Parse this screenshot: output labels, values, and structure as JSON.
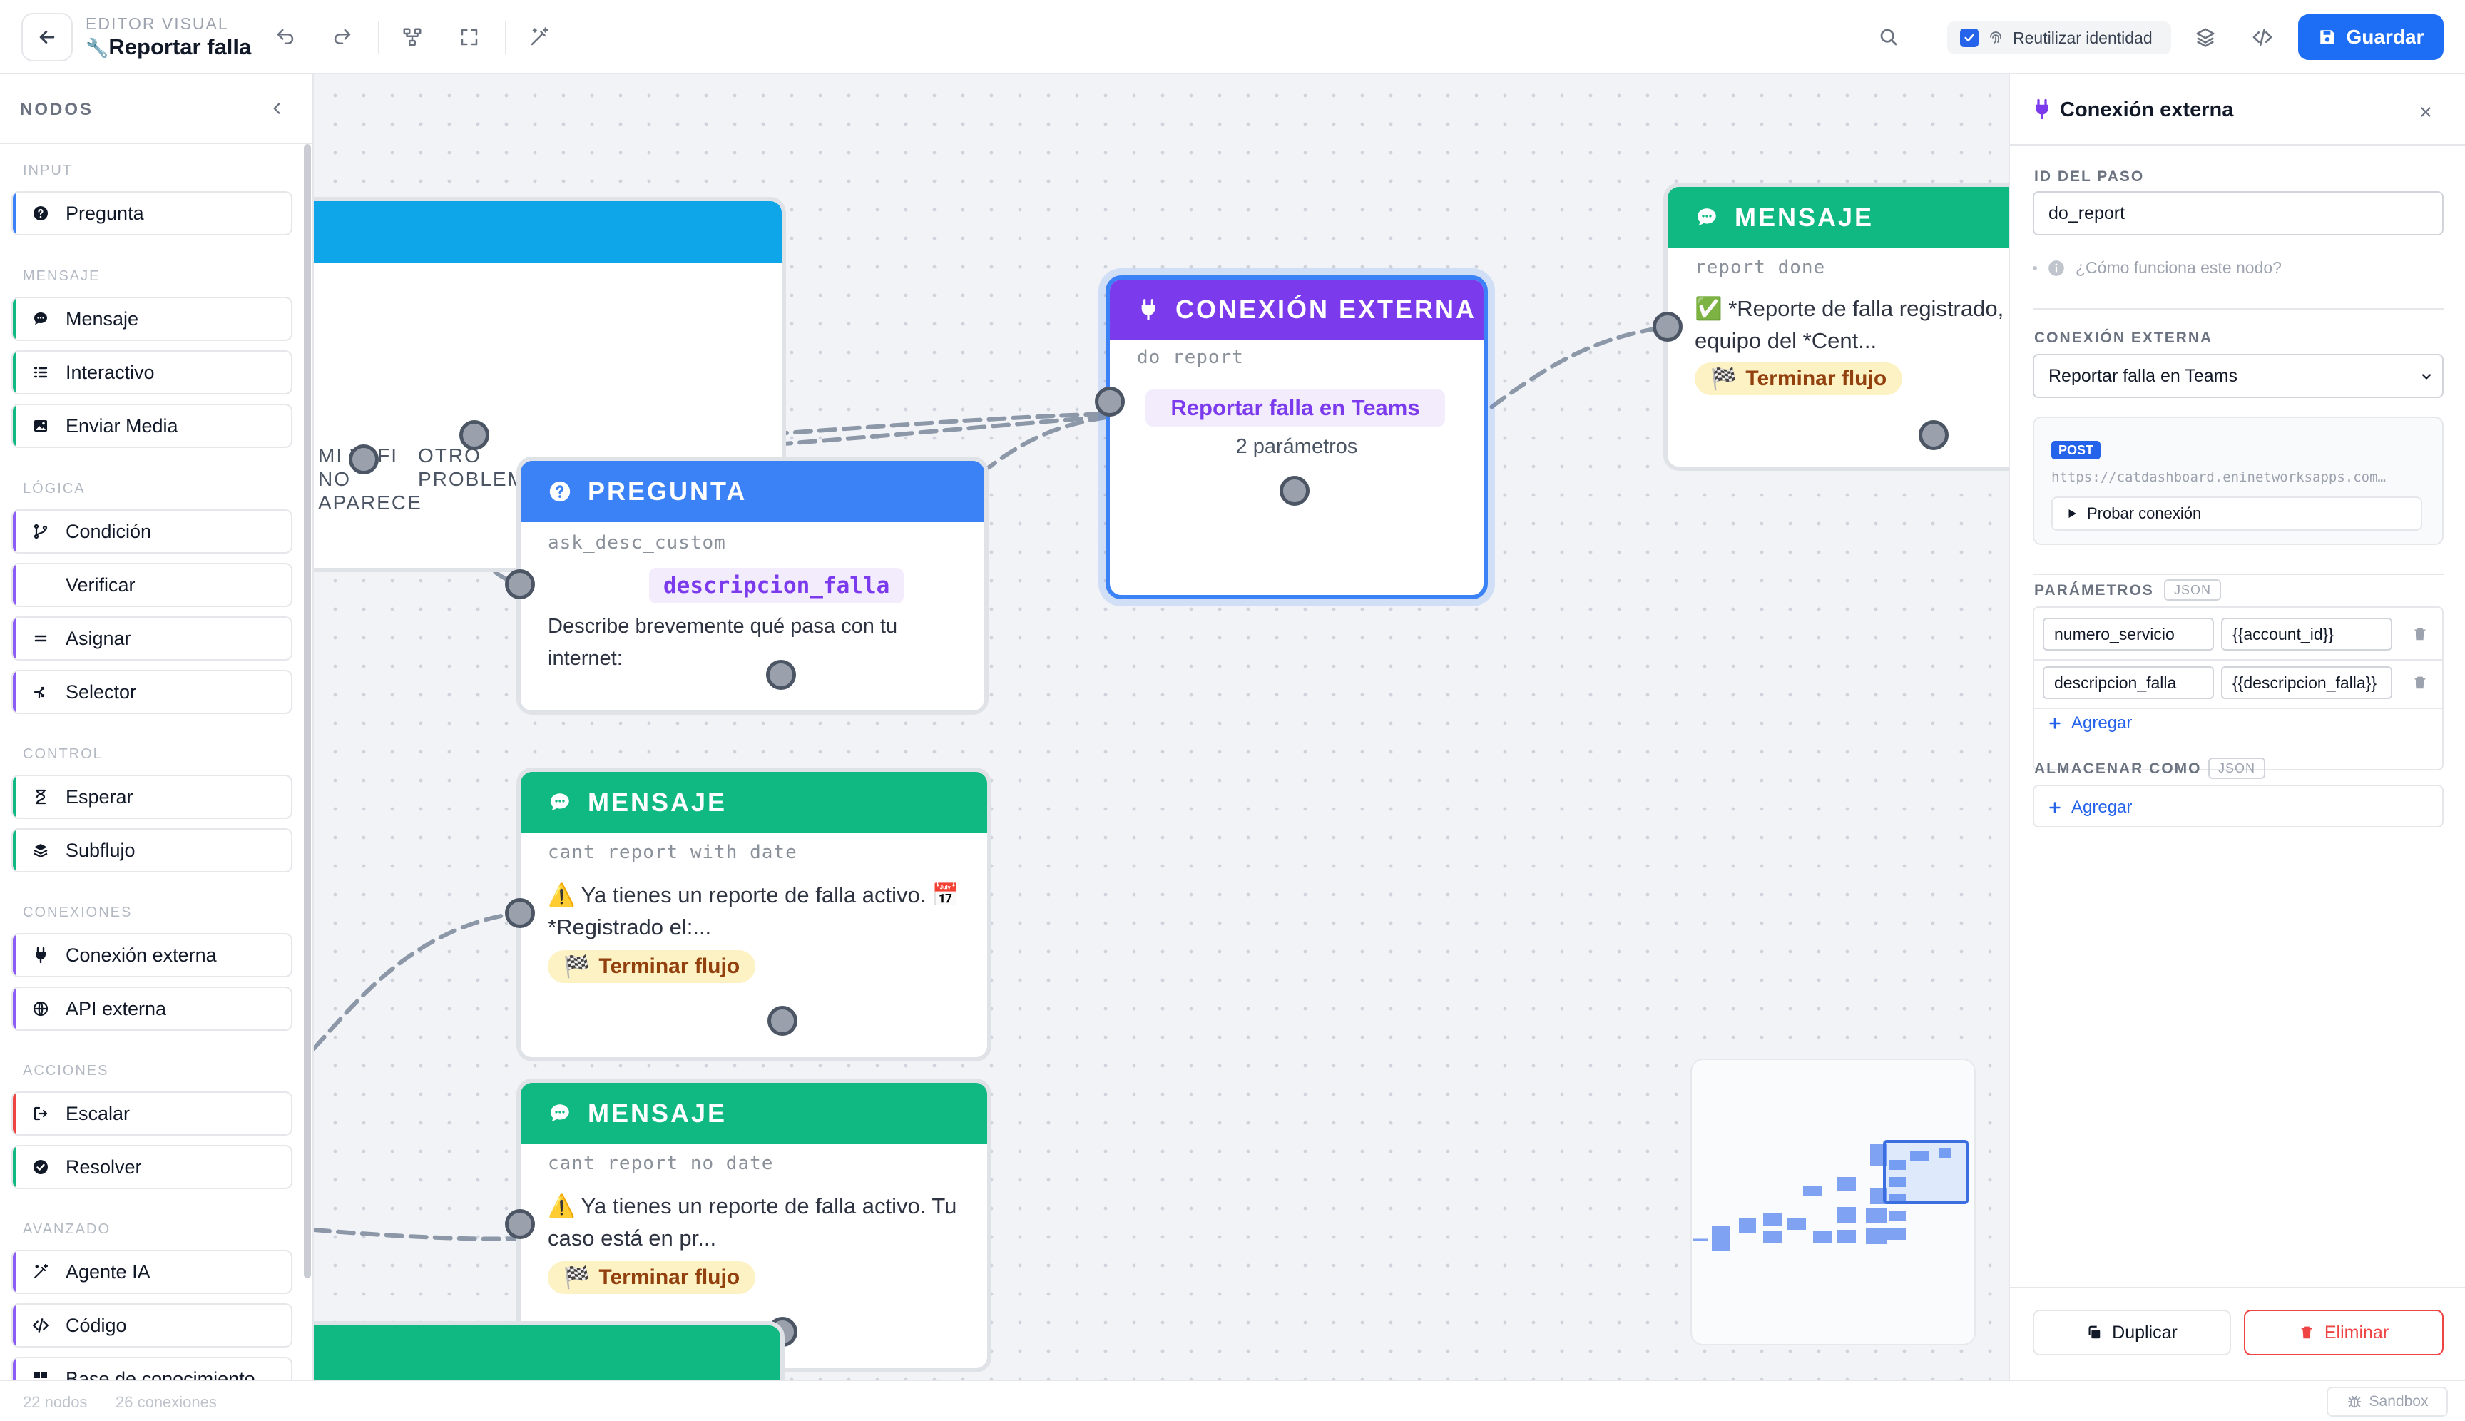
{
  "header": {
    "editor_label": "EDITOR VISUAL",
    "title": "Reportar falla",
    "reuse_identity_label": "Reutilizar identidad",
    "reuse_identity_checked": true,
    "save_label": "Guardar",
    "icons": [
      "back-arrow-icon",
      "wrench-icon",
      "undo-icon",
      "redo-icon",
      "auto-layout-icon",
      "fit-view-icon",
      "magic-wand-icon",
      "search-icon",
      "fingerprint-icon",
      "layers-icon",
      "code-icon",
      "save-icon"
    ]
  },
  "sidebar": {
    "title": "NODOS",
    "categories": [
      {
        "name": "INPUT",
        "items": [
          {
            "label": "Pregunta",
            "icon": "question-circle-icon",
            "color": "#3b82f6"
          }
        ]
      },
      {
        "name": "MENSAJE",
        "items": [
          {
            "label": "Mensaje",
            "icon": "chat-bubble-icon",
            "color": "#10b981"
          },
          {
            "label": "Interactivo",
            "icon": "list-icon",
            "color": "#10b981"
          },
          {
            "label": "Enviar Media",
            "icon": "image-icon",
            "color": "#10b981"
          }
        ]
      },
      {
        "name": "LÓGICA",
        "items": [
          {
            "label": "Condición",
            "icon": "git-branch-icon",
            "color": "#8b5cf6"
          },
          {
            "label": "Verificar",
            "icon": "",
            "color": "#8b5cf6"
          },
          {
            "label": "Asignar",
            "icon": "equals-icon",
            "color": "#8b5cf6"
          },
          {
            "label": "Selector",
            "icon": "split-icon",
            "color": "#8b5cf6"
          }
        ]
      },
      {
        "name": "CONTROL",
        "items": [
          {
            "label": "Esperar",
            "icon": "hourglass-icon",
            "color": "#10b981"
          },
          {
            "label": "Subflujo",
            "icon": "stack-icon",
            "color": "#10b981"
          }
        ]
      },
      {
        "name": "CONEXIONES",
        "items": [
          {
            "label": "Conexión externa",
            "icon": "plug-icon",
            "color": "#8b5cf6"
          },
          {
            "label": "API externa",
            "icon": "globe-icon",
            "color": "#8b5cf6"
          }
        ]
      },
      {
        "name": "ACCIONES",
        "items": [
          {
            "label": "Escalar",
            "icon": "escalate-icon",
            "color": "#ef4444"
          },
          {
            "label": "Resolver",
            "icon": "check-circle-icon",
            "color": "#10b981"
          }
        ]
      },
      {
        "name": "AVANZADO",
        "items": [
          {
            "label": "Agente IA",
            "icon": "magic-wand-icon",
            "color": "#8b5cf6"
          },
          {
            "label": "Código",
            "icon": "code-icon",
            "color": "#8b5cf6"
          },
          {
            "label": "Base de conocimiento",
            "icon": "book-icon",
            "color": "#8b5cf6"
          }
        ]
      }
    ]
  },
  "canvas": {
    "partial_node_labels": {
      "option1": "MI WIFI\nNO\nAPARECE",
      "option2": "OTRO\nPROBLEMA"
    },
    "nodes": {
      "ext": {
        "type": "CONEXIÓN EXTERNA",
        "id": "do_report",
        "connection": "Reportar falla en Teams",
        "params": "2 parámetros",
        "color": "#7c3aed"
      },
      "msg_done": {
        "type": "MENSAJE",
        "id": "report_done",
        "text": "✅ *Reporte de falla registrado, equipo del *Cent...",
        "pill": "Terminar flujo",
        "color": "#10b981"
      },
      "question": {
        "type": "PREGUNTA",
        "id": "ask_desc_custom",
        "variable": "descripcion_falla",
        "text": "Describe brevemente qué pasa con tu internet:",
        "color": "#3b82f6"
      },
      "msg_date": {
        "type": "MENSAJE",
        "id": "cant_report_with_date",
        "text": "⚠️ Ya tienes un reporte de falla activo. 📅 *Registrado el:...",
        "pill": "Terminar flujo",
        "color": "#10b981"
      },
      "msg_nodate": {
        "type": "MENSAJE",
        "id": "cant_report_no_date",
        "text": "⚠️ Ya tienes un reporte de falla activo. Tu caso está en pr...",
        "pill": "Terminar flujo",
        "color": "#10b981"
      }
    }
  },
  "panel": {
    "title": "Conexión externa",
    "step_id_label": "ID DEL PASO",
    "step_id_value": "do_report",
    "help_text": "¿Cómo funciona este nodo?",
    "connection_label": "CONEXIÓN EXTERNA",
    "connection_value": "Reportar falla en Teams",
    "method": "POST",
    "url": "https://catdashboard.eninetworksapps.com…",
    "test_label": "Probar conexión",
    "params_label": "PARÁMETROS",
    "json_badge": "JSON",
    "params": [
      {
        "key": "numero_servicio",
        "value": "{{account_id}}"
      },
      {
        "key": "descripcion_falla",
        "value": "{{descripcion_falla}}"
      }
    ],
    "add_label": "Agregar",
    "store_label": "ALMACENAR COMO",
    "store_badge": "JSON",
    "duplicate_label": "Duplicar",
    "delete_label": "Eliminar"
  },
  "footer": {
    "nodes_count": "22 nodos",
    "connections_count": "26 conexiones",
    "sandbox_label": "Sandbox"
  }
}
